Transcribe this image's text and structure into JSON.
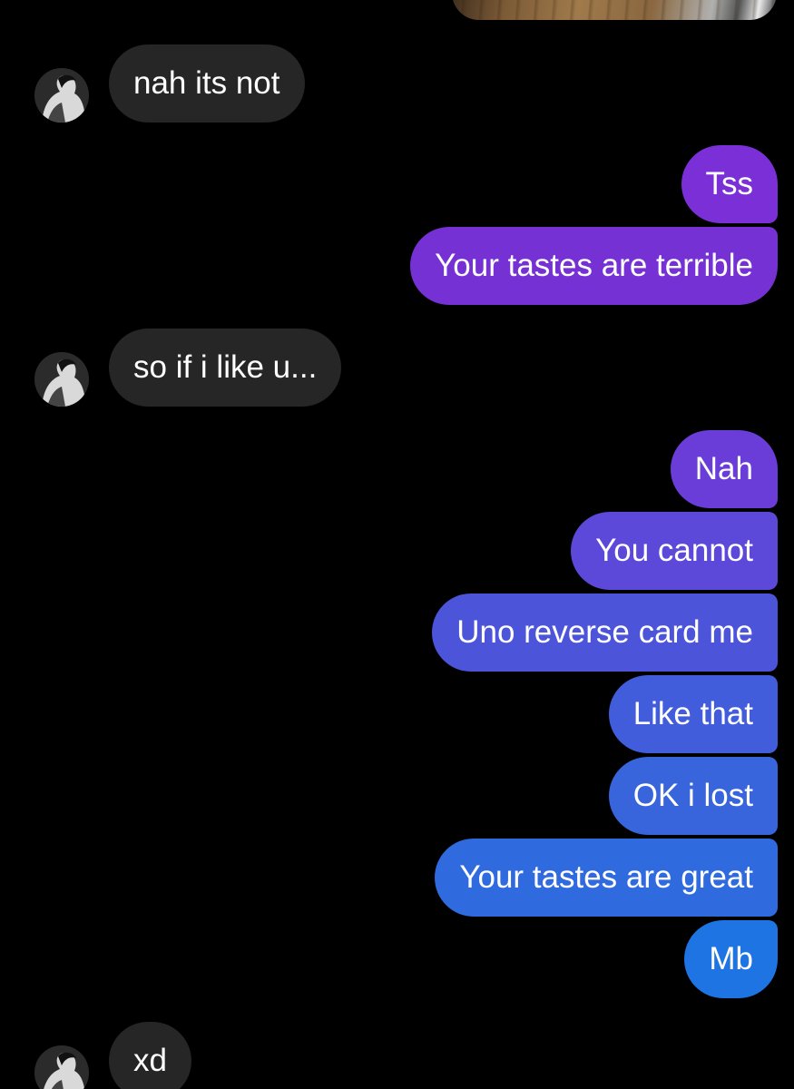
{
  "conversation": {
    "messages": [
      {
        "sender": "contact",
        "text": "nah its not"
      },
      {
        "sender": "me",
        "text": "Tss",
        "color": "#7b2fd6"
      },
      {
        "sender": "me",
        "text": "Your tastes are terrible",
        "color": "#7631d4"
      },
      {
        "sender": "contact",
        "text": "so if i like u..."
      },
      {
        "sender": "me",
        "text": "Nah",
        "color": "#6a3dd8"
      },
      {
        "sender": "me",
        "text": "You cannot",
        "color": "#5c48d9"
      },
      {
        "sender": "me",
        "text": "Uno reverse card me",
        "color": "#4c54da"
      },
      {
        "sender": "me",
        "text": "Like that",
        "color": "#425ddb"
      },
      {
        "sender": "me",
        "text": "OK i lost",
        "color": "#3864dc"
      },
      {
        "sender": "me",
        "text": "Your tastes are great",
        "color": "#2f6ade"
      },
      {
        "sender": "me",
        "text": "Mb",
        "color": "#1f74e4"
      },
      {
        "sender": "contact",
        "text": "xd"
      }
    ]
  },
  "colors": {
    "background": "#000000",
    "received_bubble": "#262626",
    "text": "#ffffff"
  }
}
